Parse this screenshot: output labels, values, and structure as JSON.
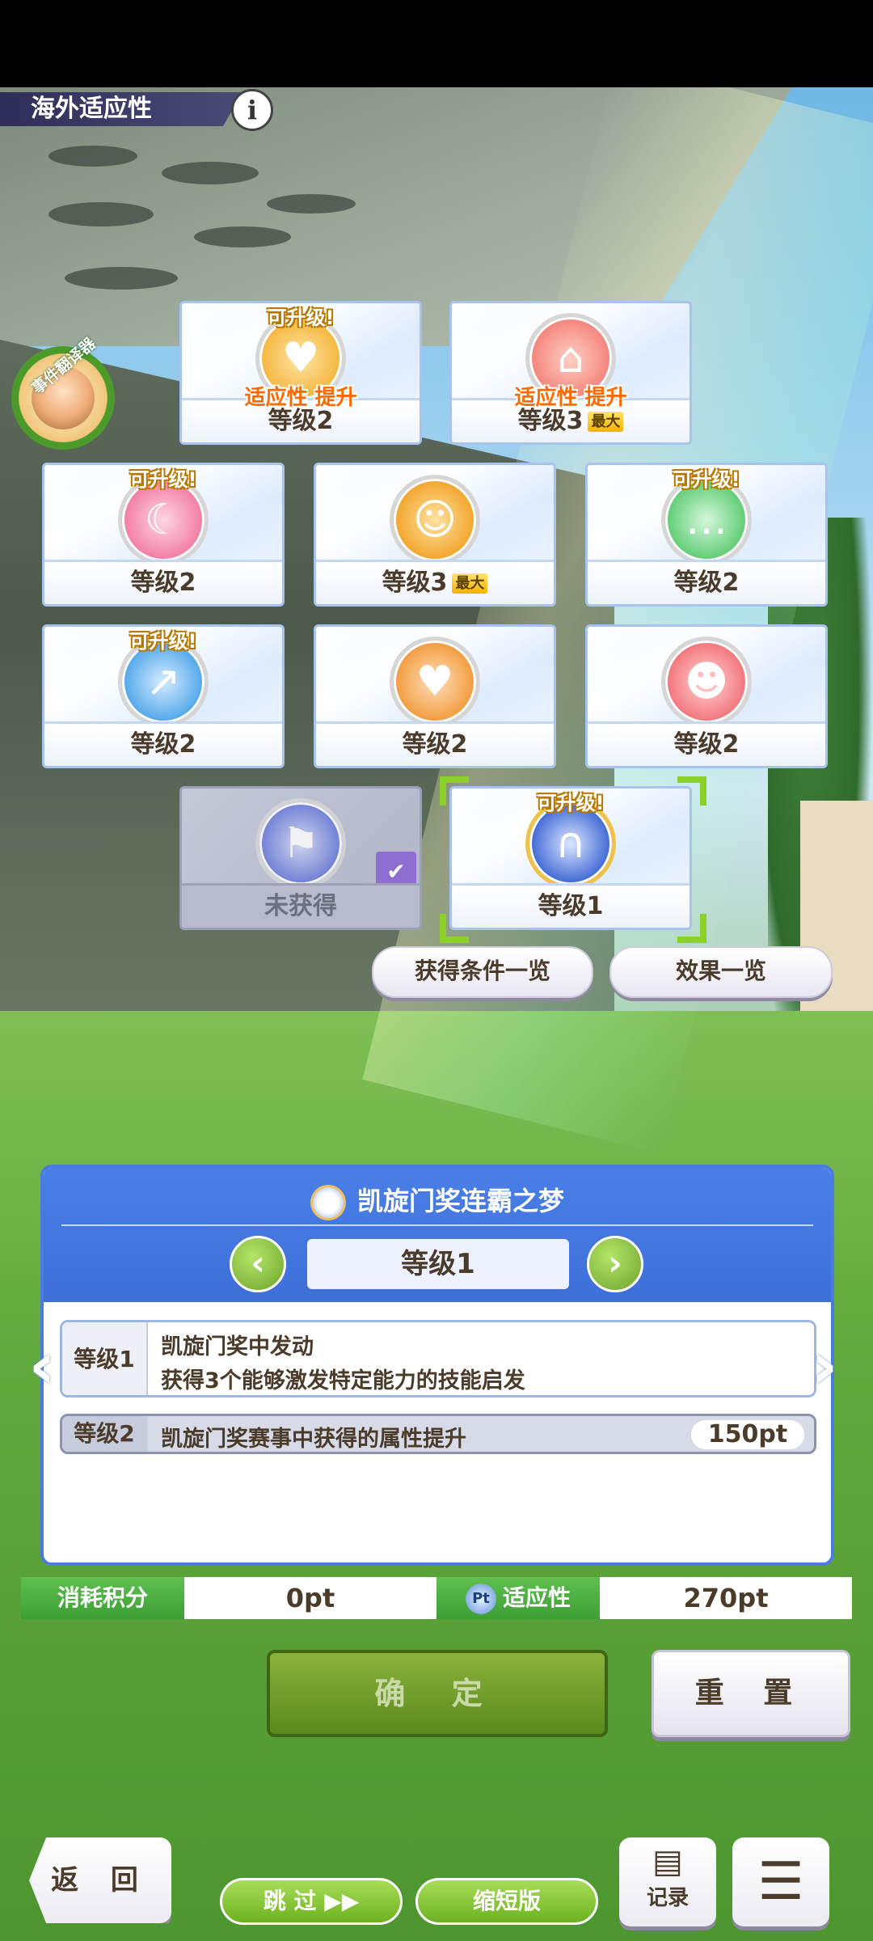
{
  "header": {
    "title": "海外适应性",
    "info_glyph": "i"
  },
  "event_badge": {
    "label": "事件翻译器"
  },
  "cards": [
    {
      "id": "c1",
      "upgrade_tag": "可升级!",
      "boost": "适应性 提升",
      "level": "等级2",
      "max": "",
      "icon": "heart-icon",
      "color": "#f5b53c"
    },
    {
      "id": "c2",
      "upgrade_tag": "",
      "boost": "适应性 提升",
      "level": "等级3",
      "max": "最大",
      "icon": "stadium-icon",
      "color": "#f4827a"
    },
    {
      "id": "c3",
      "upgrade_tag": "可升级!",
      "boost": "",
      "level": "等级2",
      "max": "",
      "icon": "sun-moon-icon",
      "color": "#f27ba2"
    },
    {
      "id": "c4",
      "upgrade_tag": "",
      "boost": "",
      "level": "等级3",
      "max": "最大",
      "icon": "food-icon",
      "color": "#f2a42a"
    },
    {
      "id": "c5",
      "upgrade_tag": "可升级!",
      "boost": "",
      "level": "等级2",
      "max": "",
      "icon": "chat-icon",
      "color": "#5dcc72"
    },
    {
      "id": "c6",
      "upgrade_tag": "可升级!",
      "boost": "",
      "level": "等级2",
      "max": "",
      "icon": "stairs-icon",
      "color": "#4ea6ea"
    },
    {
      "id": "c7",
      "upgrade_tag": "",
      "boost": "",
      "level": "等级2",
      "max": "",
      "icon": "heart-hands-icon",
      "color": "#f29a3c"
    },
    {
      "id": "c8",
      "upgrade_tag": "",
      "boost": "",
      "level": "等级2",
      "max": "",
      "icon": "devil-icon",
      "color": "#f2737a"
    },
    {
      "id": "c9",
      "upgrade_tag": "",
      "boost": "",
      "level": "未获得",
      "max": "",
      "icon": "flag-icon",
      "color": "#5c6fd6"
    },
    {
      "id": "c10",
      "upgrade_tag": "可升级!",
      "boost": "",
      "level": "等级1",
      "max": "",
      "icon": "arc-de-triomphe-icon",
      "color": "#3c66d4"
    }
  ],
  "buttons": {
    "conditions": "获得条件一览",
    "effects": "效果一览"
  },
  "panel": {
    "title": "凯旋门奖连霸之梦",
    "current_level": "等级1",
    "rows": [
      {
        "tag": "等级1",
        "line1": "凯旋门奖中发动",
        "line2": "获得3个能够激发特定能力的技能启发",
        "cost": ""
      },
      {
        "tag": "等级2",
        "line1": "凯旋门奖赛事中获得的属性提升",
        "line2": "",
        "cost": "150pt"
      }
    ]
  },
  "stats": {
    "consume_label": "消耗积分",
    "consume_value": "0pt",
    "pt_icon": "Pt",
    "adapt_label": "适应性",
    "adapt_value": "270pt"
  },
  "actions": {
    "confirm": "确 定",
    "reset": "重 置"
  },
  "footer": {
    "back": "返 回",
    "skip": "跳 过 ▶▶",
    "short": "缩短版",
    "log": "记录",
    "menu_glyph": "☰"
  }
}
